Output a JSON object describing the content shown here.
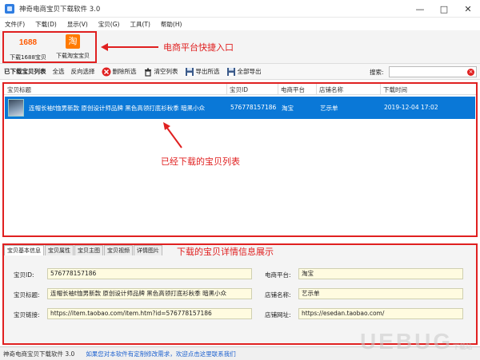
{
  "window": {
    "title": "神奇电商宝贝下载软件 3.0",
    "controls": [
      "—",
      "□",
      "✕"
    ]
  },
  "menu": [
    "文件(F)",
    "下载(D)",
    "显示(V)",
    "宝贝(G)",
    "工具(T)",
    "帮助(H)"
  ],
  "platforms": {
    "p1688": {
      "logo_text": "1688",
      "label": "下载1688宝贝"
    },
    "taobao": {
      "logo_text": "淘",
      "label": "下载淘宝宝贝"
    }
  },
  "annotations": {
    "platform": "电商平台快捷入口",
    "list": "已经下载的宝贝列表",
    "details": "下载的宝贝详情信息展示"
  },
  "toolbar": {
    "downloaded_list": "已下载宝贝列表",
    "select_all": "全选",
    "invert": "反向选择",
    "delete_selected": "删除所选",
    "clear_list": "清空列表",
    "export_selected": "导出所选",
    "export_all": "全部导出",
    "search_label": "搜索:",
    "search_value": ""
  },
  "list": {
    "columns": [
      "宝贝标题",
      "宝贝ID",
      "电商平台",
      "店铺名称",
      "下载时间"
    ],
    "rows": [
      {
        "title": "连帽长袖t恤男新款 原创设计师品牌 黑色高领打底衫秋季 暗黑小众",
        "id": "576778157186",
        "platform": "淘宝",
        "shop": "艺示单",
        "time": "2019-12-04 17:02"
      }
    ]
  },
  "details": {
    "tabs": [
      "宝贝基本信息",
      "宝贝属性",
      "宝贝主图",
      "宝贝视频",
      "详情图片"
    ],
    "labels": {
      "id": "宝贝ID:",
      "title": "宝贝标题:",
      "link": "宝贝链接:",
      "platform": "电商平台:",
      "shop": "店铺名称:",
      "shop_url": "店铺网址:"
    },
    "values": {
      "id": "576778157186",
      "title": "连帽长袖t恤男新款 原创设计师品牌 黑色高领打底衫秋季 暗黑小众",
      "link": "https://item.taobao.com/item.htm?id=576778157186",
      "platform": "淘宝",
      "shop": "艺示单",
      "shop_url": "https://esedan.taobao.com/"
    }
  },
  "status": {
    "version": "神奇电商宝贝下载软件 3.0",
    "message": "如果您对本软件有定制修改需求，欢迎点击这里联系我们"
  },
  "watermark": {
    "main": "UEBUG",
    "sub": "下载站"
  },
  "colors": {
    "accent_red": "#e02020",
    "selection_blue": "#0a78d7",
    "link_blue": "#1a5fcf",
    "field_bg": "#fffbe0"
  }
}
